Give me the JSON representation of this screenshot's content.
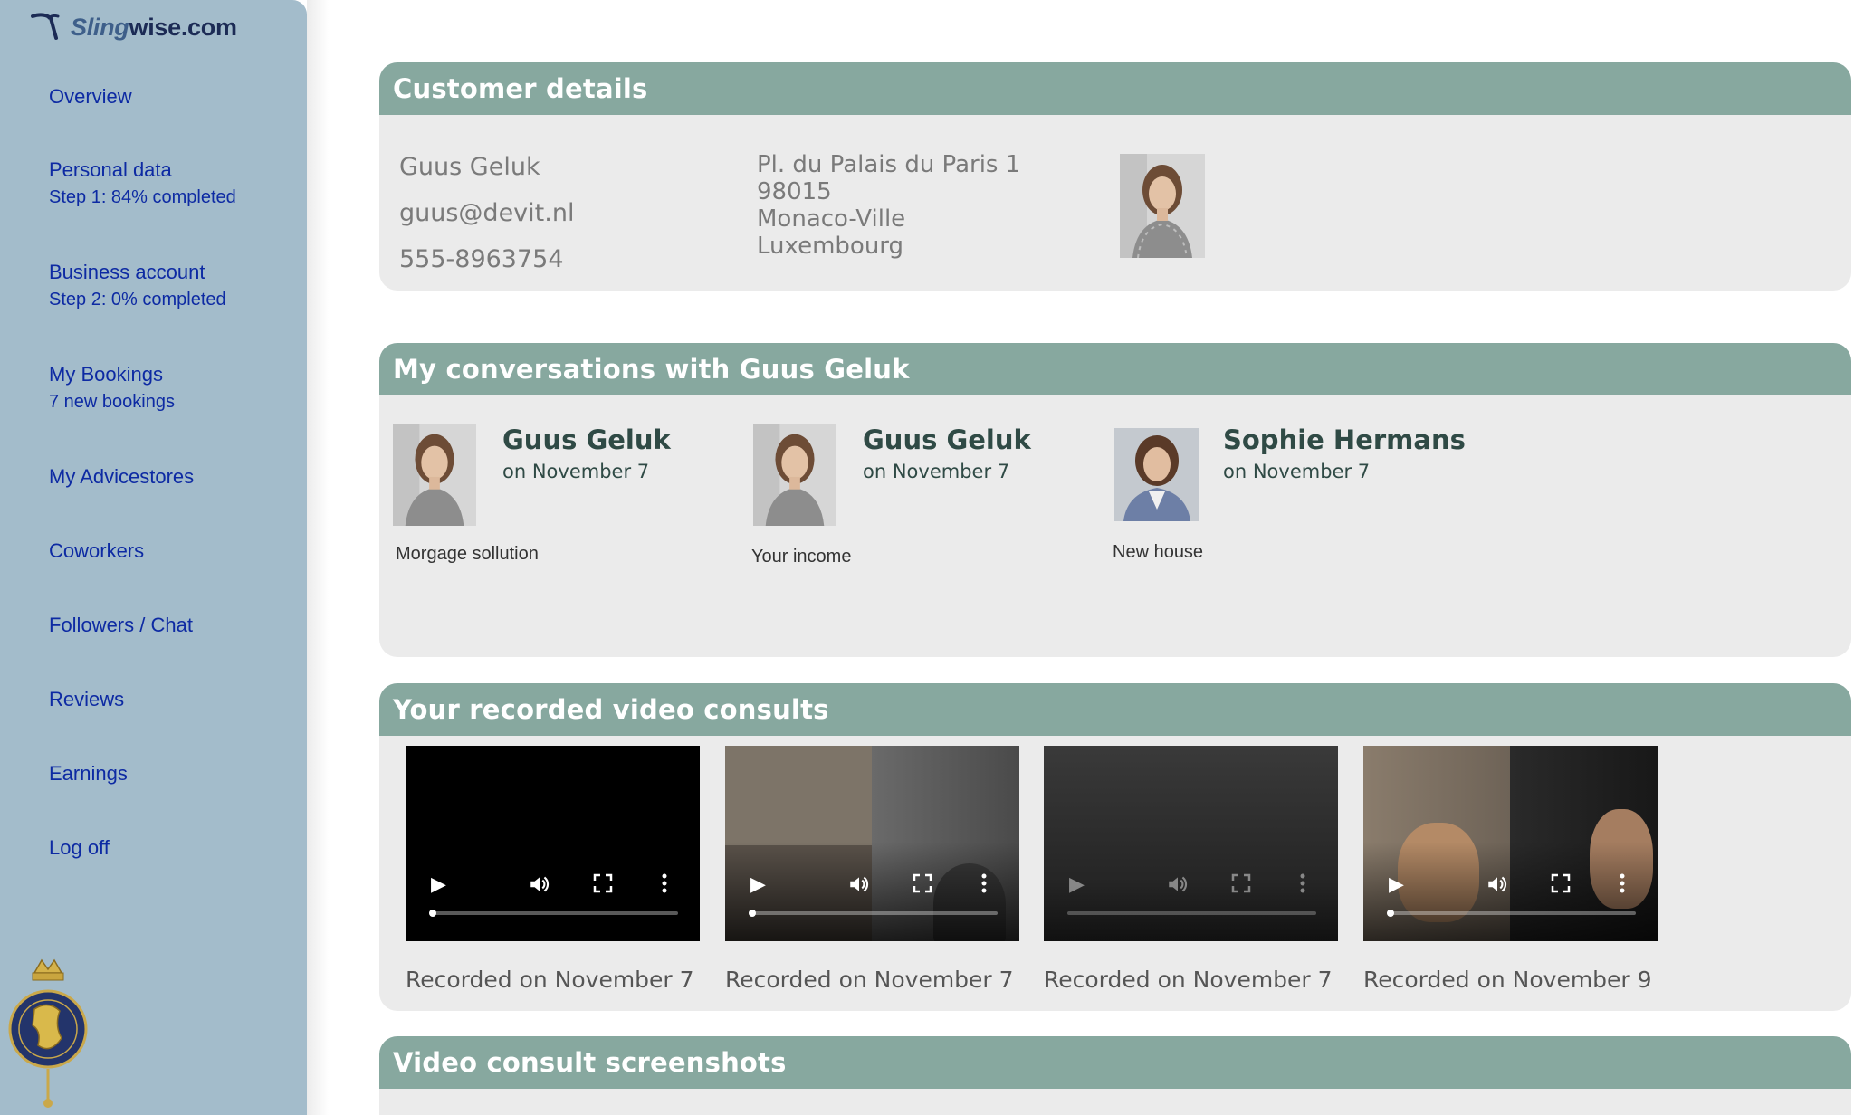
{
  "brand": {
    "logo_sling": "Sling",
    "logo_rest": "wise.com"
  },
  "sidebar": {
    "items": [
      {
        "label": "Overview"
      },
      {
        "label": "Personal data",
        "sub": "Step 1: 84% completed"
      },
      {
        "label": "Business account",
        "sub": "Step 2: 0% completed"
      },
      {
        "label": "My Bookings",
        "sub": "7 new bookings"
      },
      {
        "label": "My Advicestores"
      },
      {
        "label": "Coworkers"
      },
      {
        "label": "Followers / Chat"
      },
      {
        "label": "Reviews"
      },
      {
        "label": "Earnings"
      },
      {
        "label": "Log off"
      }
    ]
  },
  "customer": {
    "header": "Customer details",
    "name": "Guus Geluk",
    "email": "guus@devit.nl",
    "phone": "555-8963754",
    "address": [
      "Pl. du Palais du Paris 1",
      "98015",
      "Monaco-Ville",
      "Luxembourg"
    ]
  },
  "conversations": {
    "header": "My conversations with Guus Geluk",
    "items": [
      {
        "name": "Guus Geluk",
        "date": "on November 7",
        "subject": "Morgage sollution"
      },
      {
        "name": "Guus Geluk",
        "date": "on November 7",
        "subject": "Your income"
      },
      {
        "name": "Sophie Hermans",
        "date": "on November 7",
        "subject": "New house"
      }
    ]
  },
  "videos": {
    "header": "Your recorded video consults",
    "items": [
      {
        "caption": "Recorded on November 7"
      },
      {
        "caption": "Recorded on November 7"
      },
      {
        "caption": "Recorded on November 7"
      },
      {
        "caption": "Recorded on November 9"
      }
    ]
  },
  "screenshots": {
    "header": "Video consult screenshots"
  },
  "colors": {
    "sidebar": "#a3bccb",
    "header": "#87a89f",
    "panel": "#ebebeb",
    "link": "#0d2aa3"
  },
  "icons": {
    "play": "play-icon",
    "volume": "volume-icon",
    "fullscreen": "fullscreen-icon",
    "more": "more-vertical-icon"
  }
}
